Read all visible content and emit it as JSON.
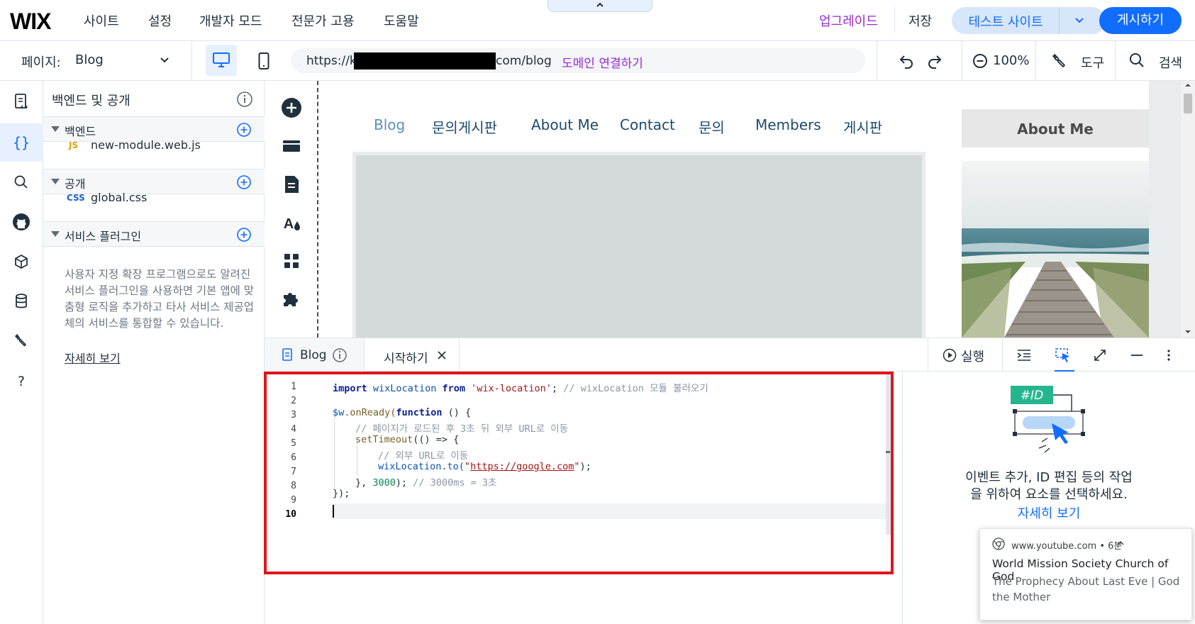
{
  "topbar": {
    "logo": "WIX",
    "menu": [
      "사이트",
      "설정",
      "개발자 모드",
      "전문가 고용",
      "도움말"
    ],
    "upgrade": "업그레이드",
    "save": "저장",
    "test_site": "테스트 사이트",
    "publish": "게시하기"
  },
  "bar2": {
    "page_prefix": "페이지:",
    "page_name": "Blog",
    "url_start": "https://k",
    "url_end": "com/blog",
    "connect_domain": "도메인 연결하기",
    "zoom": "100%",
    "tools": "도구",
    "search": "검색"
  },
  "panel": {
    "title": "백엔드 및 공개",
    "sections": [
      {
        "label": "백엔드",
        "file_badge": "JS",
        "file": "new-module.web.js"
      },
      {
        "label": "공개",
        "file_badge": "CSS",
        "file": "global.css"
      },
      {
        "label": "서비스 플러그인"
      }
    ],
    "description": "사용자 지정 확장 프로그램으로도 알려진 서비스 플러그인을 사용하면 기본 앱에 맞춤형 로직을 추가하고 타사 서비스 제공업체의 서비스를 통합할 수 있습니다.",
    "learn_more": "자세히 보기"
  },
  "canvas": {
    "nav": [
      "Blog",
      "문의게시판",
      "About Me",
      "Contact",
      "문의",
      "Members",
      "게시판"
    ],
    "about_title": "About Me"
  },
  "editor": {
    "tabs": [
      "Blog",
      "시작하기"
    ],
    "run": "실행",
    "line_numbers": [
      "1",
      "2",
      "3",
      "4",
      "5",
      "6",
      "7",
      "8",
      "9",
      "10"
    ],
    "code": {
      "l1_import": "import",
      "l1_ident": "wixLocation",
      "l1_from": "from",
      "l1_module": "'wix-location'",
      "l1_semicolon": ";",
      "l1_comment": "// wixLocation 모듈 불러오기",
      "l3_w": "$w",
      "l3_onready": ".onReady(",
      "l3_function": "function",
      "l3_rest": " () {",
      "l4_comment": "// 페이지가 로드된 후 3초 뒤 외부 URL로 이동",
      "l5_settimeout": "setTimeout",
      "l5_rest": "(() => {",
      "l6_comment": "// 외부 URL로 이동",
      "l7_call": "wixLocation.to(",
      "l7_quote_open": "\"",
      "l7_url": "https://google.com",
      "l7_quote_close": "\"",
      "l7_end": ");",
      "l8_start": "}, ",
      "l8_num": "3000",
      "l8_end": "); ",
      "l8_comment": "// 3000ms = 3초",
      "l9": "});"
    }
  },
  "help": {
    "id_tag": "#ID",
    "text_line1": "이벤트 추가, ID 편집 등의 작업",
    "text_line2": "을 위하여 요소를 선택하세요.",
    "link": "자세히 보기"
  },
  "notification": {
    "domain": "www.youtube.com",
    "age": "• 6분",
    "title": "World Mission Society Church of God",
    "body": "The Prophecy About Last Eve | God the Mother"
  },
  "colors": {
    "accent": "#116dff",
    "upgrade": "#9a27d5",
    "highlight_box": "#e0151b"
  }
}
